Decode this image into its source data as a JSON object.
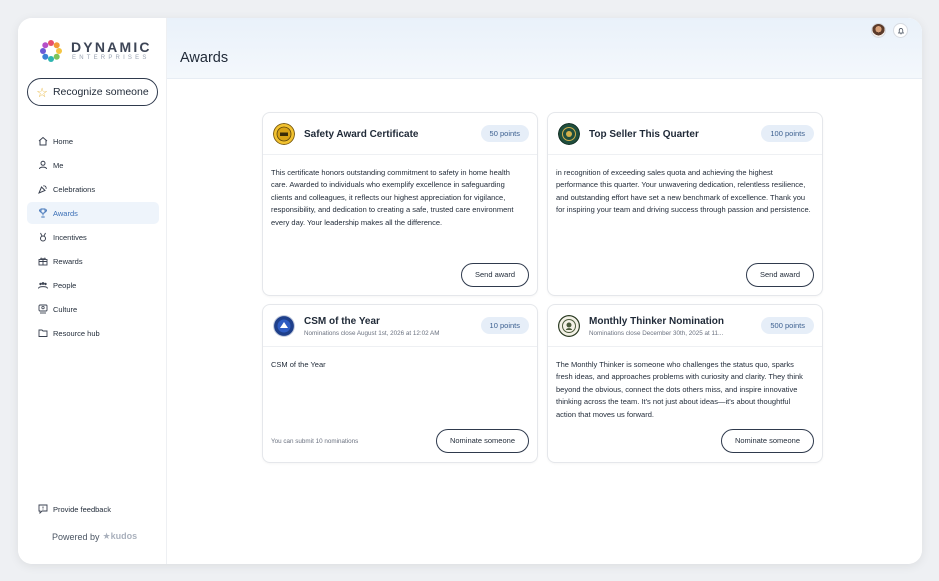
{
  "brand": {
    "name": "DYNAMIC",
    "sub": "ENTERPRISES",
    "powered_prefix": "Powered by",
    "powered_brand": "kudos"
  },
  "sidebar": {
    "recognize_label": "Recognize someone",
    "items": [
      {
        "label": "Home",
        "icon": "home-icon",
        "active": false
      },
      {
        "label": "Me",
        "icon": "user-icon",
        "active": false
      },
      {
        "label": "Celebrations",
        "icon": "party-icon",
        "active": false
      },
      {
        "label": "Awards",
        "icon": "trophy-icon",
        "active": true
      },
      {
        "label": "Incentives",
        "icon": "medal-icon",
        "active": false
      },
      {
        "label": "Rewards",
        "icon": "gift-icon",
        "active": false
      },
      {
        "label": "People",
        "icon": "people-icon",
        "active": false
      },
      {
        "label": "Culture",
        "icon": "culture-icon",
        "active": false
      },
      {
        "label": "Resource hub",
        "icon": "folder-icon",
        "active": false
      }
    ],
    "feedback_label": "Provide feedback"
  },
  "header": {
    "title": "Awards"
  },
  "cards": [
    {
      "title": "Safety Award Certificate",
      "subtitle": "",
      "points": "50 points",
      "description": "This certificate honors outstanding commitment to safety in home health care. Awarded to individuals who exemplify excellence in safeguarding clients and colleagues, it reflects our highest appreciation for vigilance, responsibility, and dedication to creating a safe, trusted care environment every day. Your leadership makes all the difference.",
      "button": "Send award",
      "limit": ""
    },
    {
      "title": "Top Seller This Quarter",
      "subtitle": "",
      "points": "100 points",
      "description": "in recognition of exceeding sales quota and achieving the highest performance this quarter. Your unwavering dedication, relentless resilience, and outstanding effort have set a new benchmark of excellence. Thank you for inspiring your team and driving success through passion and persistence.",
      "button": "Send award",
      "limit": ""
    },
    {
      "title": "CSM of the Year",
      "subtitle": "Nominations close August 1st, 2026 at 12:02 AM",
      "points": "10 points",
      "description": "CSM of the Year",
      "button": "Nominate someone",
      "limit": "You can submit 10 nominations"
    },
    {
      "title": "Monthly Thinker Nomination",
      "subtitle": "Nominations close December 30th, 2025 at 11...",
      "points": "500 points",
      "description": "The Monthly Thinker is someone who challenges the status quo, sparks fresh ideas, and approaches problems with curiosity and clarity. They think beyond the obvious, connect the dots others miss, and inspire innovative thinking across the team. It's not just about ideas—it's about thoughtful action that moves us forward.",
      "button": "Nominate someone",
      "limit": ""
    }
  ],
  "colors": {
    "accent": "#3b6fb6",
    "points_bg": "#e6eef8",
    "star": "#e8b53a"
  }
}
